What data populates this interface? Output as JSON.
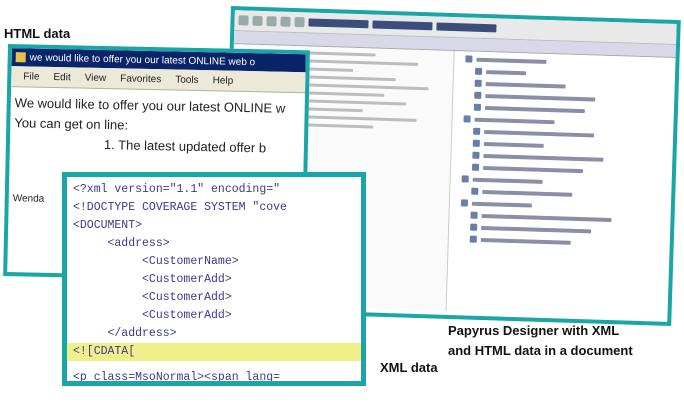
{
  "labels": {
    "html_data": "HTML data",
    "papyrus_line1": "Papyrus Designer with XML",
    "papyrus_line2": "and HTML data in a document",
    "xml_data": "XML data"
  },
  "html_window": {
    "title": "we would like to offer you our latest ONLINE web o",
    "menu": [
      "File",
      "Edit",
      "View",
      "Favorites",
      "Tools",
      "Help"
    ],
    "lines": [
      "We would like to offer you our latest ONLINE w",
      "You can get on line:",
      "1. The latest updated offer b",
      "Wenda"
    ]
  },
  "xml_window": {
    "lines": [
      "<?xml version=\"1.1\" encoding=\"",
      "<!DOCTYPE COVERAGE SYSTEM \"cove",
      "<DOCUMENT>",
      "     <address>",
      "          <CustomerName>",
      "          <CustomerAdd>",
      "          <CustomerAdd>",
      "          <CustomerAdd>",
      "     </address>",
      "<![CDATA[",
      "<p class=MsoNormal><span lang="
    ]
  },
  "colors": {
    "frame": "#1aa6a6",
    "cdata_highlight": "#f0f08a",
    "titlebar": "#0a246a"
  }
}
